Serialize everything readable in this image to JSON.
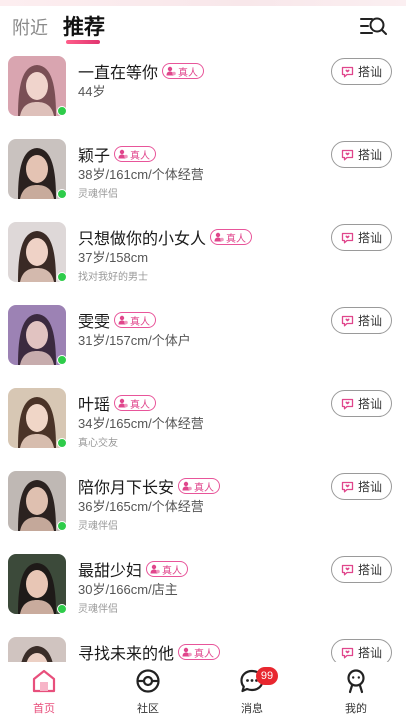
{
  "header": {
    "tab_nearby": "附近",
    "tab_recommend": "推荐"
  },
  "badge_label": "真人",
  "greet_label": "搭讪",
  "users": [
    {
      "name": "一直在等你",
      "info": "44岁",
      "sub": "",
      "online": true,
      "photo_palette": [
        "#d9a5b0",
        "#7a4f55",
        "#f0d4cc"
      ]
    },
    {
      "name": "颖子",
      "info": "38岁/161cm/个体经营",
      "sub": "灵魂伴侣",
      "online": true,
      "photo_palette": [
        "#c9c2bf",
        "#2a211f",
        "#e4c3b3"
      ]
    },
    {
      "name": "只想做你的小女人",
      "info": "37岁/158cm",
      "sub": "找对我好的男士",
      "online": true,
      "photo_palette": [
        "#ded8d8",
        "#3a2a25",
        "#efd2c6"
      ]
    },
    {
      "name": "雯雯",
      "info": "31岁/157cm/个体户",
      "sub": "",
      "online": true,
      "photo_palette": [
        "#9c82b4",
        "#3b2a3f",
        "#e1c3c1"
      ]
    },
    {
      "name": "叶瑶",
      "info": "34岁/165cm/个体经营",
      "sub": "真心交友",
      "online": true,
      "photo_palette": [
        "#d7c7b4",
        "#4a3327",
        "#f0d6c7"
      ]
    },
    {
      "name": "陪你月下长安",
      "info": "36岁/165cm/个体经营",
      "sub": "灵魂伴侣",
      "online": true,
      "photo_palette": [
        "#bfb8b4",
        "#2b2220",
        "#dfc0b0"
      ]
    },
    {
      "name": "最甜少妇",
      "info": "30岁/166cm/店主",
      "sub": "灵魂伴侣",
      "online": true,
      "photo_palette": [
        "#3c4a3a",
        "#1e1a18",
        "#e8c6b5"
      ]
    },
    {
      "name": "寻找未来的他",
      "info": "",
      "sub": "",
      "online": false,
      "photo_palette": [
        "#d0c4c0",
        "#3a2d28",
        "#ecd0c4"
      ]
    }
  ],
  "bottom_nav": {
    "home": "首页",
    "community": "社区",
    "messages": "消息",
    "messages_badge": "99",
    "mine": "我的"
  },
  "colors": {
    "accent": "#e84f7c",
    "online": "#2ecc4a",
    "badge": "#e0468c",
    "unread": "#e8272f"
  },
  "icons": {
    "search": "list-search-icon",
    "greet": "message-icon",
    "badge": "person-verified-icon",
    "home": "home-icon",
    "community": "community-icon",
    "messages": "chat-bubble-icon",
    "mine": "person-icon"
  }
}
